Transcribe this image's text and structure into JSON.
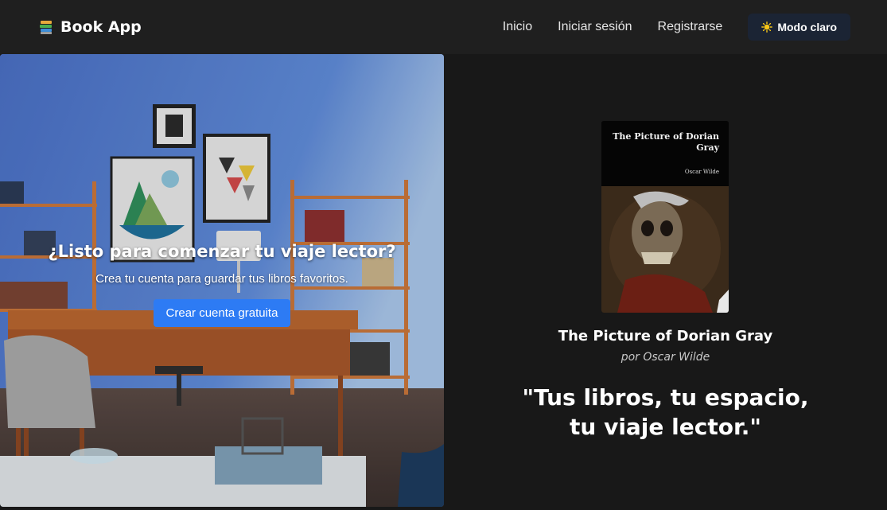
{
  "navbar": {
    "brand": "Book App",
    "brand_icon": "books-icon",
    "links": [
      "Inicio",
      "Iniciar sesión",
      "Registrarse"
    ],
    "mode_button": "Modo claro",
    "mode_icon": "sun-icon"
  },
  "hero": {
    "title": "¿Listo para comenzar tu viaje lector?",
    "subtitle": "Crea tu cuenta para guardar tus libros favoritos.",
    "cta": "Crear cuenta gratuita",
    "image": "home-office-interior-photo"
  },
  "featured": {
    "cover_title": "The Picture of Dorian Gray",
    "cover_author": "Oscar Wilde",
    "title": "The Picture of Dorian Gray",
    "author": "por Oscar Wilde",
    "quote": "\"Tus libros, tu espacio, tu viaje lector.\""
  },
  "colors": {
    "background": "#181818",
    "navbar": "#1f1f1f",
    "mode_button": "#1b2434",
    "cta": "#2d7bf4"
  }
}
